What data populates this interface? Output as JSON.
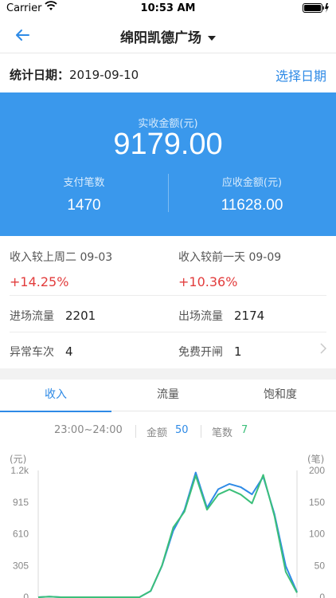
{
  "status": {
    "carrier": "Carrier",
    "time": "10:53 AM"
  },
  "nav": {
    "title": "绵阳凯德广场"
  },
  "date_row": {
    "label": "统计日期：",
    "date": "2019-09-10",
    "pick": "选择日期"
  },
  "hero": {
    "caption": "实收金额(元)",
    "amount": "9179.00",
    "left_label": "支付笔数",
    "left_value": "1470",
    "right_label": "应收金额(元)",
    "right_value": "11628.00"
  },
  "compare": {
    "week_label": "收入较上周二 09-03",
    "week_value": "+14.25%",
    "day_label": "收入较前一天 09-09",
    "day_value": "+10.36%"
  },
  "flow": {
    "in_label": "进场流量",
    "in_value": "2201",
    "out_label": "出场流量",
    "out_value": "2174",
    "abn_label": "异常车次",
    "abn_value": "4",
    "free_label": "免费开闸",
    "free_value": "1"
  },
  "tabs": [
    "收入",
    "流量",
    "饱和度"
  ],
  "legend": {
    "range": "23:00~24:00",
    "amount_label": "金额",
    "amount_value": "50",
    "count_label": "笔数",
    "count_value": "7"
  },
  "colors": {
    "blue": "#2e8ae6",
    "green": "#3cbf7a",
    "hero": "#3a98ec",
    "red": "#e23c3c"
  },
  "chart_data": {
    "type": "line",
    "left_unit": "(元)",
    "right_unit": "(笔)",
    "left_ticks": [
      "1.2k",
      "915",
      "610",
      "305",
      "0"
    ],
    "right_ticks": [
      "200",
      "150",
      "100",
      "50",
      "0"
    ],
    "ylim_left": [
      0,
      1220
    ],
    "ylim_right": [
      0,
      200
    ],
    "x": [
      0,
      1,
      2,
      3,
      4,
      5,
      6,
      7,
      8,
      9,
      10,
      11,
      12,
      13,
      14,
      15,
      16,
      17,
      18,
      19,
      20,
      21,
      22,
      23
    ],
    "series": [
      {
        "axis": "left",
        "color": "#2e8ae6",
        "values": [
          0,
          5,
          0,
          0,
          0,
          0,
          0,
          0,
          0,
          0,
          60,
          300,
          640,
          840,
          1200,
          860,
          1040,
          1090,
          1060,
          990,
          1160,
          800,
          300,
          50
        ]
      },
      {
        "axis": "right",
        "color": "#3cbf7a",
        "values": [
          0,
          1,
          0,
          0,
          0,
          0,
          0,
          0,
          0,
          0,
          10,
          50,
          110,
          135,
          192,
          138,
          162,
          170,
          162,
          148,
          193,
          128,
          40,
          7
        ]
      }
    ]
  }
}
